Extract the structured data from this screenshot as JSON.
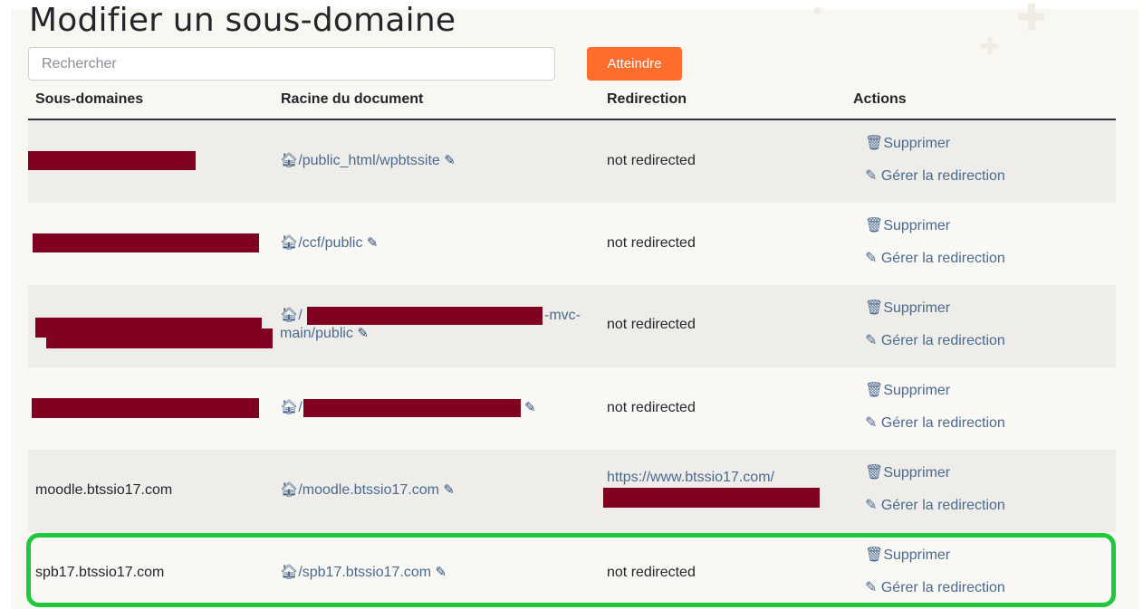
{
  "page": {
    "title": "Modifier un sous-domaine",
    "search_placeholder": "Rechercher",
    "search_button": "Atteindre"
  },
  "table": {
    "headers": [
      "Sous-domaines",
      "Racine du document",
      "Redirection",
      "Actions"
    ],
    "rows": [
      {
        "subdomain": "",
        "root": "/public_html/wpbtssite",
        "redirect": "not redirected"
      },
      {
        "subdomain": "",
        "root": "/ccf/public",
        "redirect": "not redirected"
      },
      {
        "subdomain": "",
        "root_line1": "/",
        "root_line1_suffix": "-mvc-",
        "root_line2": "main/public",
        "redirect": "not redirected"
      },
      {
        "subdomain": "",
        "root": "/",
        "redirect": "not redirected"
      },
      {
        "subdomain": "moodle.btssio17.com",
        "root": "/moodle.btssio17.com",
        "redirect": "https://www.btssio17.com/"
      },
      {
        "subdomain": "spb17.btssio17.com",
        "root": "/spb17.btssio17.com",
        "redirect": "not redirected"
      }
    ],
    "actions": {
      "delete": "Supprimer",
      "manage": "Gérer la redirection"
    }
  },
  "colors": {
    "accent": "#ff6c2c",
    "link": "#4a6a8e",
    "redaction": "#800020",
    "highlight": "#1fc83b"
  },
  "icons": [
    "home-icon",
    "pencil-icon",
    "trash-icon"
  ]
}
